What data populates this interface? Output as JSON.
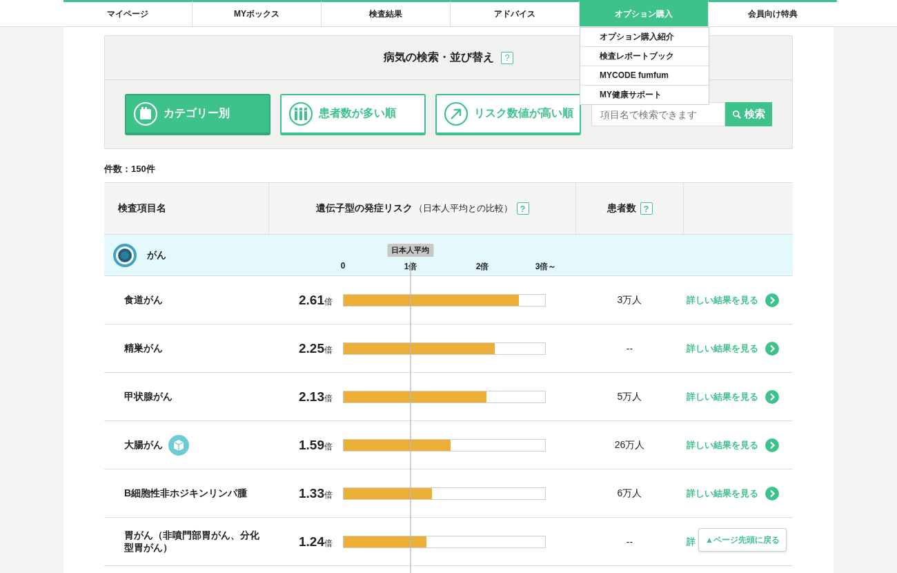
{
  "nav": [
    {
      "label": "マイページ",
      "selected": false
    },
    {
      "label": "MYボックス",
      "selected": false
    },
    {
      "label": "検査結果",
      "selected": false
    },
    {
      "label": "アドバイス",
      "selected": false
    },
    {
      "label": "オプション購入",
      "selected": true
    },
    {
      "label": "会員向け特典",
      "selected": false
    }
  ],
  "dropdown": [
    "オプション購入紹介",
    "検査レポートブック",
    "MYCODE fumfum",
    "MY健康サポート"
  ],
  "search_panel": {
    "title": "病気の検索・並び替え",
    "help": "?",
    "sort_buttons": [
      {
        "label": "カテゴリー別",
        "kind": "category",
        "selected": true
      },
      {
        "label": "患者数が多い順",
        "kind": "people",
        "selected": false
      },
      {
        "label": "リスク数値が高い順",
        "kind": "risk",
        "selected": false
      }
    ],
    "search": {
      "placeholder": "項目名で検索できます",
      "button": "検索"
    }
  },
  "count": "件数：150件",
  "table": {
    "columns": [
      {
        "label": "検査項目名"
      },
      {
        "label": "遺伝子型の発症リスク",
        "note": "（日本人平均との比較）",
        "help": "?"
      },
      {
        "label": "患者数",
        "help": "?"
      }
    ],
    "category": {
      "label": "がん",
      "average_badge": "日本人平均",
      "scale": [
        "0",
        "1倍",
        "2倍",
        "3倍～"
      ]
    },
    "rows": [
      {
        "name": "食道がん",
        "marked": false,
        "value": "2.61",
        "unit": "倍",
        "level": 0.87,
        "patients": "3万人",
        "link": "詳しい結果を見る",
        "chevron": true
      },
      {
        "name": "精巣がん",
        "marked": false,
        "value": "2.25",
        "unit": "倍",
        "level": 0.75,
        "patients": "--",
        "link": "詳しい結果を見る",
        "chevron": true
      },
      {
        "name": "甲状腺がん",
        "marked": false,
        "value": "2.13",
        "unit": "倍",
        "level": 0.71,
        "patients": "5万人",
        "link": "詳しい結果を見る",
        "chevron": true
      },
      {
        "name": "大腸がん",
        "marked": true,
        "value": "1.59",
        "unit": "倍",
        "level": 0.53,
        "patients": "26万人",
        "link": "詳しい結果を見る",
        "chevron": true
      },
      {
        "name": "B細胞性非ホジキンリンパ腫",
        "marked": false,
        "value": "1.33",
        "unit": "倍",
        "level": 0.44,
        "patients": "6万人",
        "link": "詳しい結果を見る",
        "chevron": true
      },
      {
        "name": "胃がん（非噴門部胃がん、分化型胃がん）",
        "marked": false,
        "value": "1.24",
        "unit": "倍",
        "level": 0.41,
        "patients": "--",
        "link": "詳",
        "chevron": false
      }
    ]
  },
  "back_to_top": "▲ページ先頭に戻る"
}
